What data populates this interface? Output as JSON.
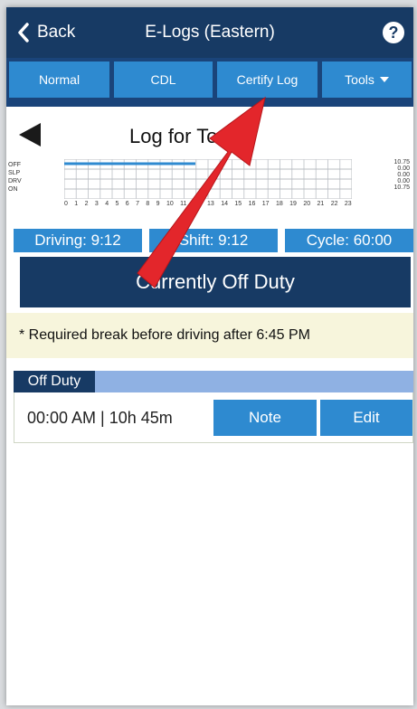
{
  "header": {
    "back_label": "Back",
    "title": "E-Logs (Eastern)",
    "help": "?"
  },
  "nav": {
    "tabs": [
      {
        "label": "Normal"
      },
      {
        "label": "CDL"
      },
      {
        "label": "Certify Log"
      },
      {
        "label": "Tools"
      }
    ]
  },
  "log": {
    "title": "Log for Today",
    "row_labels": [
      "OFF",
      "SLP",
      "DRV",
      "ON"
    ],
    "hours": [
      "0",
      "1",
      "2",
      "3",
      "4",
      "5",
      "6",
      "7",
      "8",
      "9",
      "10",
      "11",
      "12",
      "13",
      "14",
      "15",
      "16",
      "17",
      "18",
      "19",
      "20",
      "21",
      "22",
      "23"
    ],
    "totals": [
      "10.75",
      "0.00",
      "0.00",
      "0.00",
      "10.75"
    ]
  },
  "stats": {
    "driving": "Driving: 9:12",
    "shift": "Shift: 9:12",
    "cycle": "Cycle: 60:00"
  },
  "status": {
    "current": "Currently Off Duty",
    "break_note": "* Required break before driving after 6:45 PM"
  },
  "entries": {
    "tab_label": "Off Duty",
    "rows": [
      {
        "time_duration": "00:00 AM | 10h 45m",
        "note_label": "Note",
        "edit_label": "Edit"
      }
    ]
  },
  "colors": {
    "header_bg": "#173a64",
    "accent": "#2e8ad0",
    "annotation_arrow": "#e3262b"
  }
}
